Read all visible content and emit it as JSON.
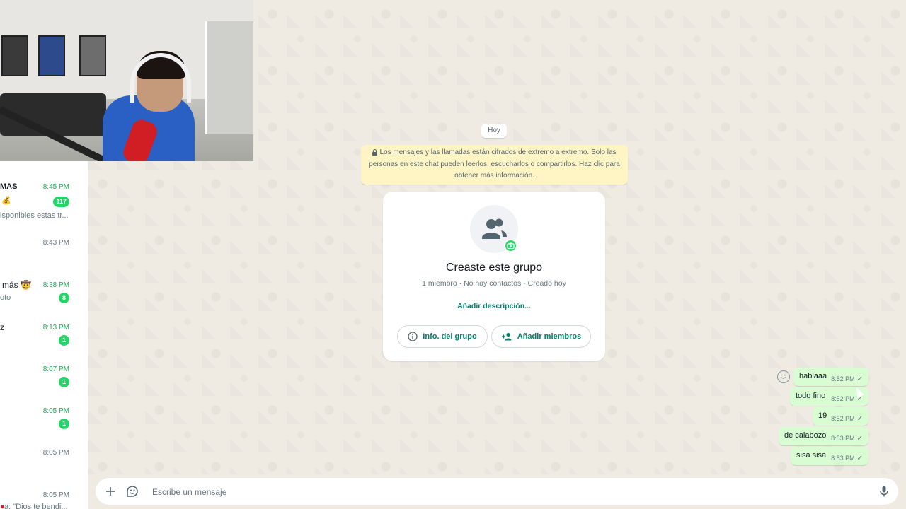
{
  "chat_list": [
    {
      "name": "MAS",
      "preview": "💰",
      "preview2": "isponibles estas tr...",
      "time": "8:45 PM",
      "time_green": true,
      "badge": "117"
    },
    {
      "name": "",
      "preview": "",
      "time": "8:43 PM",
      "time_green": false,
      "badge": ""
    },
    {
      "name": "más 🤠",
      "preview": "oto",
      "time": "8:38 PM",
      "time_green": true,
      "badge": "8"
    },
    {
      "name": "z",
      "preview": "",
      "time": "8:13 PM",
      "time_green": true,
      "badge": "1"
    },
    {
      "name": "",
      "preview": "",
      "time": "8:07 PM",
      "time_green": true,
      "badge": "1"
    },
    {
      "name": "",
      "preview": "",
      "time": "8:05 PM",
      "time_green": true,
      "badge": "1"
    },
    {
      "name": "",
      "preview": "",
      "time": "8:05 PM",
      "time_green": false,
      "badge": ""
    },
    {
      "name": "",
      "preview": "a: \"Dios te bendi...",
      "time": "8:05 PM",
      "time_green": false,
      "badge": ""
    }
  ],
  "conversation": {
    "date_label": "Hoy",
    "encryption_notice": "Los mensajes y las llamadas están cifrados de extremo a extremo. Solo las personas en este chat pueden leerlos, escucharlos o compartirlos. Haz clic para obtener más información.",
    "group_card": {
      "title": "Creaste este grupo",
      "subtitle": "1 miembro · No hay contactos · Creado hoy",
      "add_description": "Añadir descripción...",
      "info_button": "Info. del grupo",
      "add_members_button": "Añadir miembros"
    },
    "messages": [
      {
        "text": "hablaaa",
        "time": "8:52 PM",
        "check": "✓"
      },
      {
        "text": "todo fino",
        "time": "8:52 PM",
        "check": "✓"
      },
      {
        "text": "19",
        "time": "8:52 PM",
        "check": "✓"
      },
      {
        "text": "de calabozo",
        "time": "8:53 PM",
        "check": "✓"
      },
      {
        "text": "sisa sisa",
        "time": "8:53 PM",
        "check": "✓"
      }
    ]
  },
  "composer": {
    "placeholder": "Escribe un mensaje",
    "value": ""
  },
  "colors": {
    "accent": "#008069",
    "badge": "#25d366",
    "outgoing_bubble": "#d9fdd3",
    "encryption_bg": "#fff5c4"
  },
  "icons": [
    "plus-icon",
    "sticker-icon",
    "microphone-icon",
    "lock-icon",
    "group-icon",
    "camera-icon",
    "info-icon",
    "add-person-icon",
    "emoji-icon",
    "check-icon"
  ]
}
